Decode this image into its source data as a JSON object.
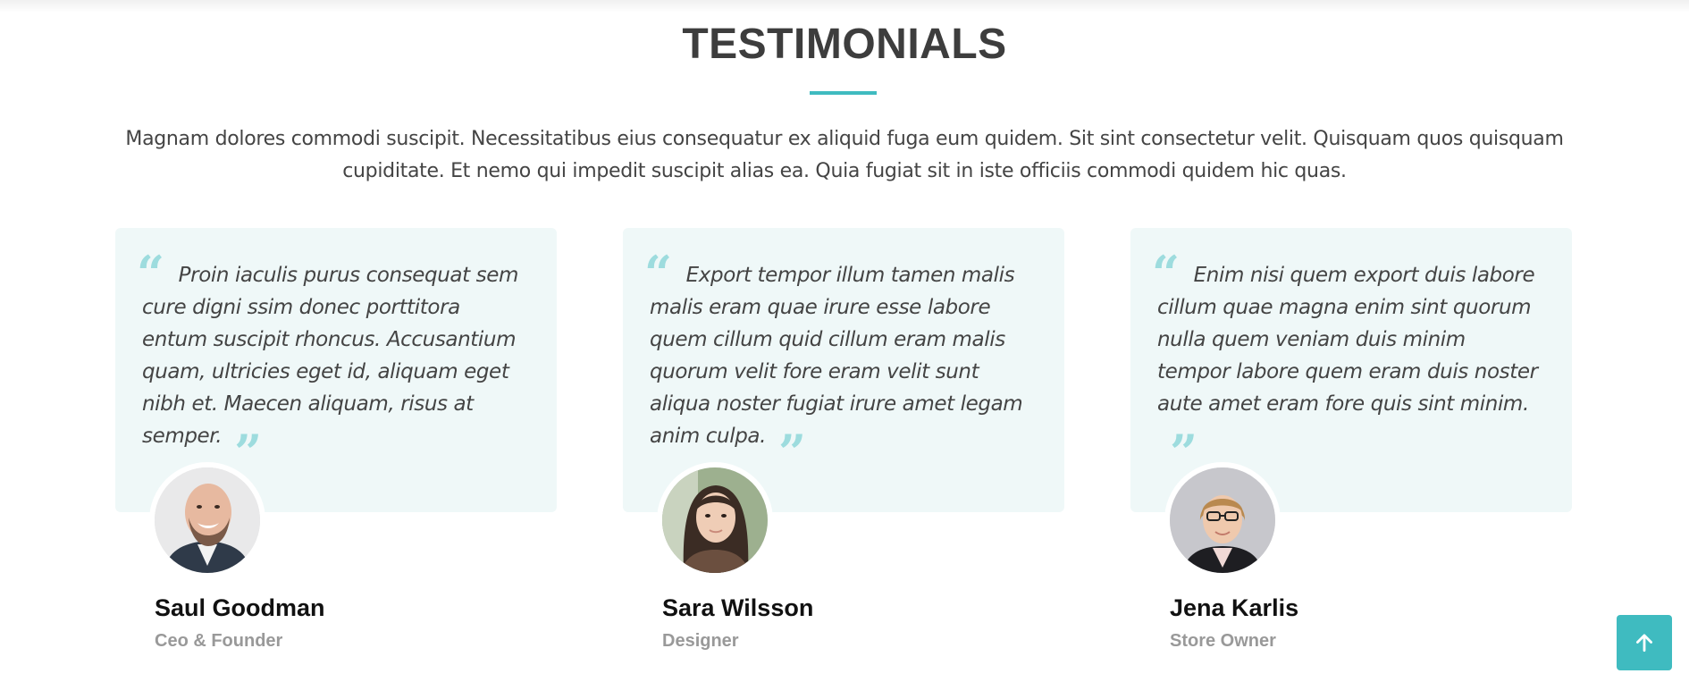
{
  "section": {
    "title": "TESTIMONIALS",
    "description": "Magnam dolores commodi suscipit. Necessitatibus eius consequatur ex aliquid fuga eum quidem. Sit sint consectetur velit. Quisquam quos quisquam cupiditate. Et nemo qui impedit suscipit alias ea. Quia fugiat sit in iste officiis commodi quidem hic quas."
  },
  "testimonials": [
    {
      "quote": "Proin iaculis purus consequat sem cure digni ssim donec porttitora entum suscipit rhoncus. Accusantium quam, ultricies eget id, aliquam eget nibh et. Maecen aliquam, risus at semper.",
      "name": "Saul Goodman",
      "role": "Ceo & Founder"
    },
    {
      "quote": "Export tempor illum tamen malis malis eram quae irure esse labore quem cillum quid cillum eram malis quorum velit fore eram velit sunt aliqua noster fugiat irure amet legam anim culpa.",
      "name": "Sara Wilsson",
      "role": "Designer"
    },
    {
      "quote": "Enim nisi quem export duis labore cillum quae magna enim sint quorum nulla quem veniam duis minim tempor labore quem eram duis noster aute amet eram fore quis sint minim.",
      "name": "Jena Karlis",
      "role": "Store Owner"
    }
  ],
  "icons": {
    "quote_open": "quote-left-icon",
    "quote_close": "quote-right-icon",
    "back_to_top": "arrow-up-icon"
  },
  "colors": {
    "accent": "#3fbbc0",
    "card_background": "#eff8f8",
    "quote_mark": "#9ddcde"
  }
}
